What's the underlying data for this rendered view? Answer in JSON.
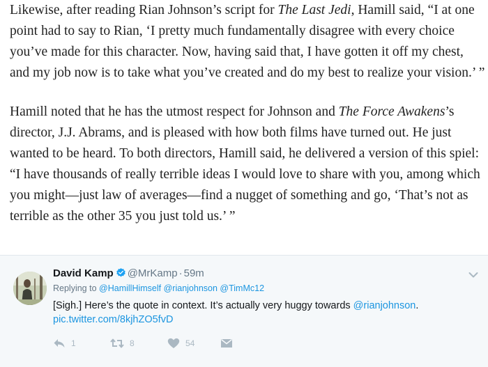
{
  "article": {
    "para1": {
      "t1": "Likewise, after reading Rian Johnson’s script for ",
      "title": "The Last Jedi",
      "t2": ", Hamill said, “I at one point had to say to Rian, ‘I pretty much fundamentally disagree with every choice you’ve made for this character. Now, having said that, I have gotten it off my chest, and my job now is to take what you’ve created and do my best to realize your vision.’ ”"
    },
    "para2": {
      "t1": "Hamill noted that he has the utmost respect for Johnson and ",
      "title": "The Force Awakens",
      "t2": "’s director, J.J. Abrams, and is pleased with how both films have turned out. He just wanted to be heard. To both directors, Hamill said, he delivered a version of this spiel: “I have thousands of really terrible ideas I would love to share with you, among which you might—just law of averages—find a nugget of something and go, ‘That’s not as terrible as the other 35 you just told us.’ ”"
    }
  },
  "tweet": {
    "display_name": "David Kamp",
    "handle": "@MrKamp",
    "separator": "·",
    "time": "59m",
    "replying_prefix": "Replying to",
    "replying_to": [
      "@HamillHimself",
      "@rianjohnson",
      "@TimMc12"
    ],
    "text_before": "[Sigh.] Here’s the quote in context. It’s actually very huggy towards ",
    "text_mention": "@rianjohnson",
    "text_after": ".",
    "pic_link": "pic.twitter.com/8kjhZO5fvD",
    "reply_count": "1",
    "retweet_count": "8",
    "like_count": "54",
    "icons": {
      "verified": "verified-badge-icon",
      "more": "chevron-down-icon",
      "reply": "reply-icon",
      "retweet": "retweet-icon",
      "like": "heart-icon",
      "message": "direct-message-icon"
    },
    "colors": {
      "link": "#1b95e0",
      "verified": "#1da1f2",
      "muted": "#657786",
      "action": "#aab8c2",
      "card_bg": "#f5f8fa"
    }
  }
}
